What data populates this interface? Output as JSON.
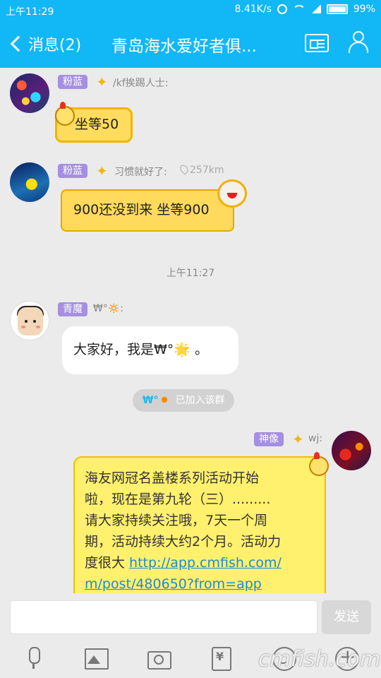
{
  "status_bar": {
    "time": "上午11:29",
    "network_speed": "8.41K/s",
    "battery": "99%",
    "icons": [
      "alarm-icon",
      "wifi-icon",
      "signal-icon",
      "battery-icon"
    ]
  },
  "header": {
    "back_label": "消息(2)",
    "title": "青岛海水爱好者俱...",
    "icons": [
      "group-card-icon",
      "group-members-icon"
    ],
    "background_color": "#12b7f5"
  },
  "messages": [
    {
      "badge": "粉蓝",
      "sender": "/kf挨踢人士:",
      "text": "坐等50"
    },
    {
      "badge": "粉蓝",
      "sender": "习惯就好了:",
      "distance": "257km",
      "text": "900还没到来 坐等900"
    },
    {
      "time_divider": "上午11:27"
    },
    {
      "badge": "青魔",
      "sender": "₩°🔅:",
      "text": "大家好，我是₩°🌟 。"
    },
    {
      "system_notice_name": "₩°",
      "system_notice": "已加入该群"
    },
    {
      "badge": "神像",
      "sender": "wj:",
      "text_lines": [
        "海友网冠名盖楼系列活动开始",
        "啦，现在是第九轮（三）.........",
        "请大家持续关注哦，7天一个周",
        "期，活动持续大约2个月。活动力",
        "度很大 "
      ],
      "link_lines": [
        "http://app.cmfish.com/",
        "m/post/480650?from=app"
      ]
    }
  ],
  "input_bar": {
    "placeholder": "",
    "send_label": "发送",
    "tools": [
      "mic-icon",
      "image-icon",
      "camera-icon",
      "red-packet-icon",
      "emoji-icon",
      "plus-icon"
    ],
    "watermark": "cmfish.com"
  }
}
